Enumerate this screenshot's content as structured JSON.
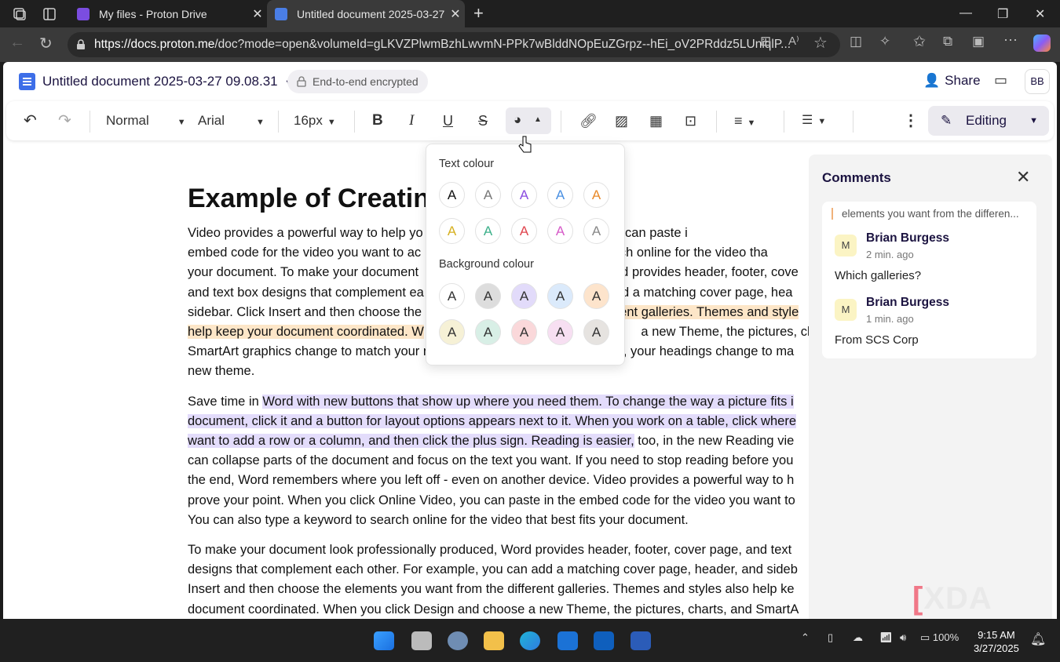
{
  "browser": {
    "tabs": [
      {
        "title": "My files - Proton Drive"
      },
      {
        "title": "Untitled document 2025-03-27 09.08.31"
      }
    ],
    "url_host": "https://docs.proton.me",
    "url_path": "/doc?mode=open&volumeId=gLKVZPlwmBzhLwvmN-PPk7wBlddNOpEuZGrpz--hEi_oV2PRddz5LUniqlP..."
  },
  "doc": {
    "title": "Untitled document 2025-03-27 09.08.31",
    "encryption": "End-to-end encrypted",
    "share": "Share",
    "avatar": "BB"
  },
  "toolbar": {
    "style": "Normal",
    "font": "Arial",
    "size": "16px",
    "mode": "Editing"
  },
  "popover": {
    "text_heading": "Text colour",
    "bg_heading": "Background colour",
    "glyph": "A",
    "text_colors": [
      "#111111",
      "#777777",
      "#8a4be0",
      "#4a90e2",
      "#e88a2a",
      "#d6b020",
      "#3cb08a",
      "#e0454e",
      "#d65bc8",
      "#888888"
    ],
    "bg_colors": [
      "#ffffff",
      "#dddddd",
      "#e2dbfa",
      "#dbeafb",
      "#fde4cc",
      "#f6f1d6",
      "#d8efe6",
      "#fad8da",
      "#f7dff2",
      "#e6e3e0"
    ]
  },
  "content": {
    "heading": "Example of Creatin",
    "p1": [
      "Video provides a powerful way to help yo",
      "k Online Video, you can paste i",
      "embed code for the video you want to ac",
      " search online for the video tha",
      "your document. To make your document ",
      "rd provides header, footer, cove",
      "and text box designs that complement ea",
      "dd a matching cover page, hea",
      "sidebar. Click Insert and then choose the ",
      "rent galleries. Themes and style",
      "help keep your document coordinated. W",
      " a new Theme, the pictures, ch",
      "SmartArt graphics change to match your new theme. When you apply styles, your headings change to ma",
      "new theme."
    ],
    "p2_l1a": "Save time in ",
    "p2_l1b": "Word with new buttons that show up where you need them. To change the way a picture fits i",
    "p2_l2": "document, click it and a button for layout options appears next to it. When you work on a table, click where",
    "p2_l3a": "want to add a row or a column, and then click the plus sign. Reading is easier,",
    "p2_l3b": " too, in the new Reading vie",
    "p2_rest": [
      "can collapse parts of the document and focus on the text you want. If you need to stop reading before you",
      "the end, Word remembers where you left off - even on another device. Video provides a powerful way to h",
      "prove your point. When you click Online Video, you can paste in the embed code for the video you want to",
      "You can also type a keyword to search online for the video that best fits your document."
    ],
    "p3": [
      "To make your document look professionally produced, Word provides header, footer, cover page, and text",
      "designs that complement each other. For example, you can add a matching cover page, header, and sideb",
      "Insert and then choose the elements you want from the different galleries. Themes and styles also help ke",
      "document coordinated. When you click Design and choose a new Theme, the pictures, charts, and SmartA"
    ]
  },
  "comments": {
    "title": "Comments",
    "quote": "elements you want from the differen...",
    "items": [
      {
        "initial": "M",
        "name": "Brian Burgess",
        "time": "2 min. ago",
        "text": "Which galleries?"
      },
      {
        "initial": "M",
        "name": "Brian Burgess",
        "time": "1 min. ago",
        "text": "From SCS Corp"
      }
    ]
  },
  "watermark": "XDA",
  "taskbar": {
    "battery": "100%",
    "time": "9:15 AM",
    "date": "3/27/2025"
  }
}
